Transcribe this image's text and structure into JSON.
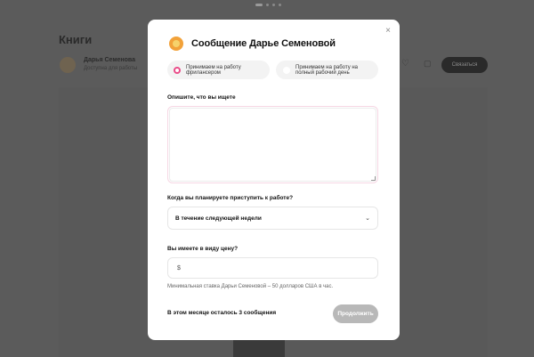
{
  "background": {
    "page_title": "Книги",
    "designer_name": "Дарья Семенова",
    "status": "Доступна для работы",
    "primary_action": "Связаться"
  },
  "modal": {
    "title": "Сообщение Дарье Семеновой",
    "close_glyph": "×",
    "options": [
      {
        "label_line1": "Принимаем на работу",
        "label_line2": "фрилансером",
        "selected": true
      },
      {
        "label_line1": "Принимаем на работу на",
        "label_line2": "полный рабочий день",
        "selected": false
      }
    ],
    "description_label": "Опишите, что вы ищете",
    "description_value": "",
    "start_label": "Когда вы планируете приступить к работе?",
    "start_value": "В течение следующей недели",
    "price_label": "Вы имеете в виду цену?",
    "price_prefix": "$",
    "price_value": "",
    "price_hint": "Минимальная ставка Дарьи Семеновой – 50 долларов США в час.",
    "messages_left": "В этом месяце осталось 3 сообщения",
    "continue_label": "Продолжить"
  },
  "colors": {
    "accent": "#ea4c89",
    "overlay": "#5b5b5b",
    "button_disabled": "#b8b8b8"
  }
}
